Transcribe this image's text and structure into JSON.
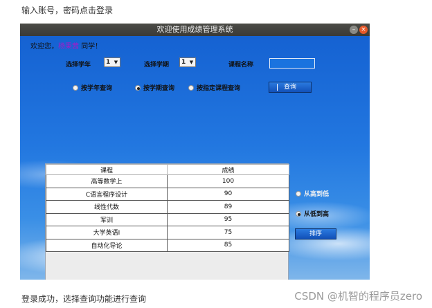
{
  "caption_top": "输入账号，密码点击登录",
  "caption_bottom": "登录成功，选择查询功能进行查询",
  "watermark": "CSDN @机智的程序员zero",
  "window": {
    "title": "欢迎使用成绩管理系统",
    "minimize_glyph": "–",
    "close_glyph": "×"
  },
  "welcome": {
    "prefix": "欢迎您，",
    "username": "杨秉茜",
    "suffix": " 同学！"
  },
  "filters": {
    "year_label": "选择学年",
    "year_value": "1",
    "term_label": "选择学期",
    "term_value": "1",
    "course_label": "课程名称",
    "course_value": ""
  },
  "query_modes": [
    {
      "label": "按学年查询",
      "selected": false
    },
    {
      "label": "按学期查询",
      "selected": true
    },
    {
      "label": "按指定课程查询",
      "selected": false
    }
  ],
  "query_button": "查询",
  "table": {
    "headers": [
      "课程",
      "成绩"
    ],
    "rows": [
      [
        "高等数学上",
        "100"
      ],
      [
        "C语言程序设计",
        "90"
      ],
      [
        "线性代数",
        "89"
      ],
      [
        "军训",
        "95"
      ],
      [
        "大学英语I",
        "75"
      ],
      [
        "自动化导论",
        "85"
      ]
    ]
  },
  "sort": {
    "options": [
      {
        "label": "从高到低",
        "selected": false
      },
      {
        "label": "从低到高",
        "selected": true
      }
    ],
    "button": "排序"
  },
  "colors": {
    "username": "#a01cc9",
    "client_bg": "#1f6fdc",
    "close_button": "#e8592a"
  },
  "icons": [
    "dropdown-arrow-icon",
    "minimize-icon",
    "close-icon",
    "radio-icon"
  ]
}
